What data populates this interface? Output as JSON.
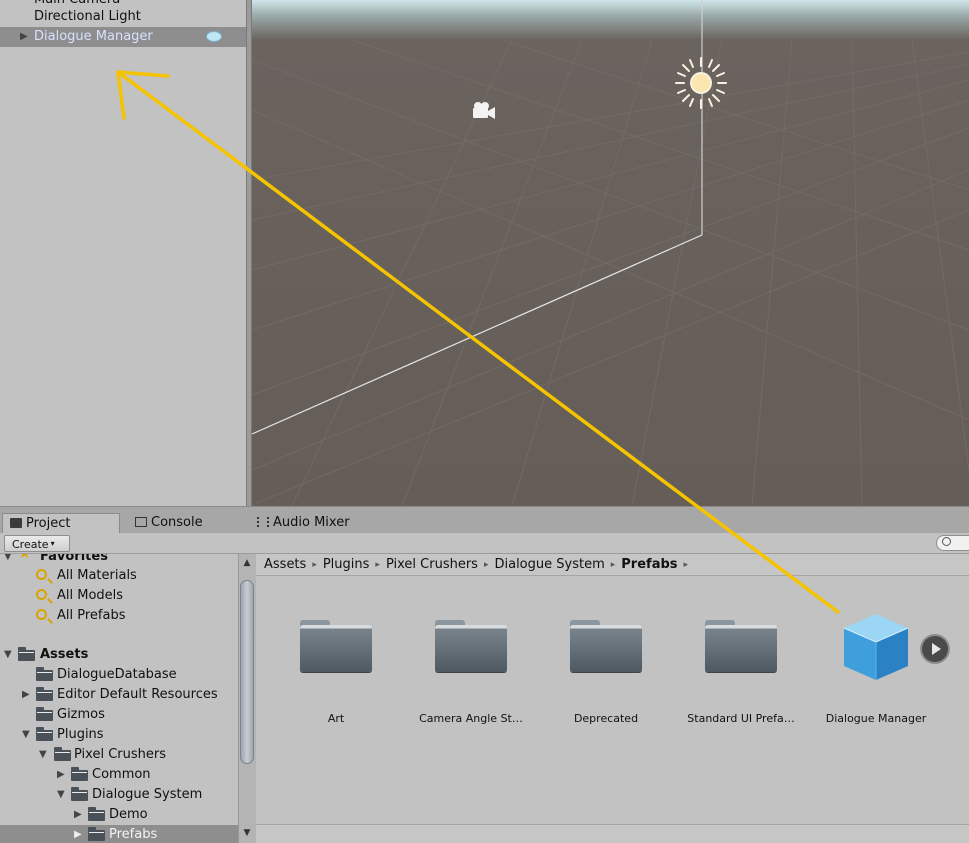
{
  "hierarchy": {
    "items": [
      {
        "label": "Main Camera"
      },
      {
        "label": "Directional Light"
      },
      {
        "label": "Dialogue Manager"
      }
    ]
  },
  "tabs": [
    {
      "label": "Project",
      "icon": "folder-icon"
    },
    {
      "label": "Console",
      "icon": "console-icon"
    },
    {
      "label": "Audio Mixer",
      "icon": "audio-mixer-icon"
    }
  ],
  "toolbar": {
    "create_label": "Create",
    "create_caret": "▾",
    "search_placeholder": ""
  },
  "tree": {
    "favorites_label": "Favorites",
    "favorites": [
      "All Materials",
      "All Models",
      "All Prefabs"
    ],
    "assets_label": "Assets",
    "assets": [
      {
        "label": "DialogueDatabase"
      },
      {
        "label": "Editor Default Resources"
      },
      {
        "label": "Gizmos"
      },
      {
        "label": "Plugins"
      },
      {
        "label": "Pixel Crushers"
      },
      {
        "label": "Common"
      },
      {
        "label": "Dialogue System"
      },
      {
        "label": "Demo"
      },
      {
        "label": "Prefabs"
      }
    ]
  },
  "breadcrumb": [
    "Assets",
    "Plugins",
    "Pixel Crushers",
    "Dialogue System",
    "Prefabs"
  ],
  "breadcrumb_sep": "▸",
  "grid": {
    "items": [
      {
        "label": "Art",
        "type": "folder"
      },
      {
        "label": "Camera Angle St…",
        "type": "folder"
      },
      {
        "label": "Deprecated",
        "type": "folder"
      },
      {
        "label": "Standard UI Prefa…",
        "type": "folder"
      },
      {
        "label": "Dialogue Manager",
        "type": "prefab"
      }
    ]
  },
  "colors": {
    "annotation_arrow": "#f5c400",
    "selection": "#8e8e8e",
    "prefab_blue": "#3fa3e0"
  }
}
